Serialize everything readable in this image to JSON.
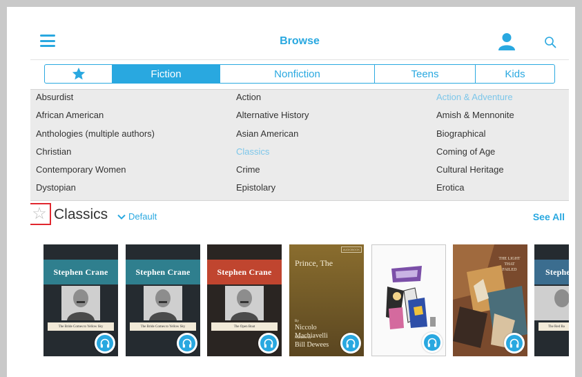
{
  "header": {
    "title": "Browse",
    "icons": [
      "hamburger-menu-icon",
      "user-icon",
      "search-icon"
    ]
  },
  "tabs": [
    {
      "label": "",
      "icon": "star-icon",
      "active": false
    },
    {
      "label": "Fiction",
      "active": true
    },
    {
      "label": "Nonfiction",
      "active": false
    },
    {
      "label": "Teens",
      "active": false
    },
    {
      "label": "Kids",
      "active": false
    }
  ],
  "genres": [
    {
      "label": "Absurdist"
    },
    {
      "label": "Action"
    },
    {
      "label": "Action & Adventure",
      "highlighted": true
    },
    {
      "label": "African American"
    },
    {
      "label": "Alternative History"
    },
    {
      "label": "Amish & Mennonite"
    },
    {
      "label": "Anthologies (multiple authors)"
    },
    {
      "label": "Asian American"
    },
    {
      "label": "Biographical"
    },
    {
      "label": "Christian"
    },
    {
      "label": "Classics",
      "highlighted": true
    },
    {
      "label": "Coming of Age"
    },
    {
      "label": "Contemporary Women"
    },
    {
      "label": "Crime"
    },
    {
      "label": "Cultural Heritage"
    },
    {
      "label": "Dystopian"
    },
    {
      "label": "Epistolary"
    },
    {
      "label": "Erotica"
    }
  ],
  "section": {
    "title": "Classics",
    "sort_label": "Default",
    "see_all_label": "See All"
  },
  "books": [
    {
      "author_band": "Stephen Crane",
      "subtitle": "The Bride Comes to Yellow Sky",
      "band_color": "#2f7f8e"
    },
    {
      "author_band": "Stephen Crane",
      "subtitle": "The Bride Comes to Yellow Sky",
      "band_color": "#2f7f8e"
    },
    {
      "author_band": "Stephen Crane",
      "subtitle": "The Open Boat",
      "band_color": "#c0452f"
    },
    {
      "title": "Prince, The",
      "author_prefix": "By",
      "author": "Niccolo Machiavelli",
      "narrated_prefix": "Narrated by",
      "narrator": "Bill Dewees",
      "tag": "AUDIOBOOK"
    },
    {
      "art": "illustrated-cover"
    },
    {
      "art": "collage-cover",
      "title": "The Light That Failed"
    },
    {
      "author_band": "Stephen",
      "subtitle": "The Red Ba",
      "band_color": "#3b6d8f"
    }
  ],
  "colors": {
    "accent": "#29a8e0",
    "highlight_link": "#7cc6ea",
    "panel_bg": "#ebebeb",
    "focus_outline": "#e0262e"
  }
}
